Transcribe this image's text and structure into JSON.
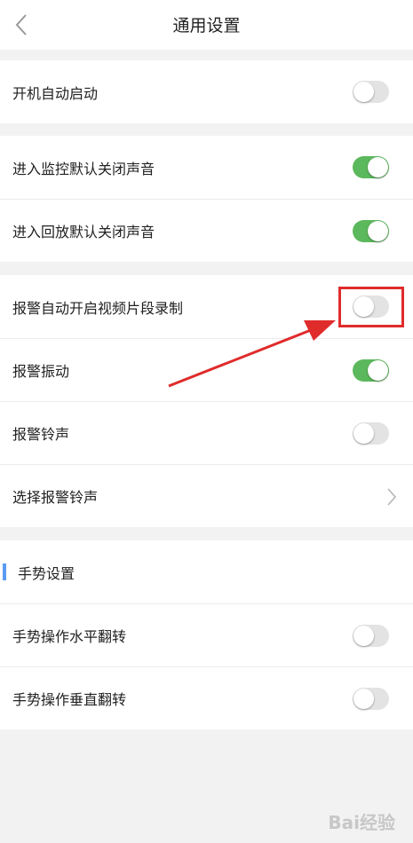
{
  "header": {
    "title": "通用设置"
  },
  "groups": [
    {
      "rows": [
        {
          "label": "开机自动启动",
          "toggle": false
        }
      ]
    },
    {
      "rows": [
        {
          "label": "进入监控默认关闭声音",
          "toggle": true
        },
        {
          "label": "进入回放默认关闭声音",
          "toggle": true
        }
      ]
    },
    {
      "rows": [
        {
          "label": "报警自动开启视频片段录制",
          "toggle": false
        },
        {
          "label": "报警振动",
          "toggle": true
        },
        {
          "label": "报警铃声",
          "toggle": false
        },
        {
          "label": "选择报警铃声",
          "chevron": true
        }
      ]
    },
    {
      "section_title": "手势设置",
      "rows": [
        {
          "label": "手势操作水平翻转",
          "toggle": false
        },
        {
          "label": "手势操作垂直翻转",
          "toggle": false
        }
      ]
    }
  ],
  "colors": {
    "toggle_on": "#5cb85c",
    "toggle_off": "#e3e3e3",
    "accent_bar": "#5b9bf3",
    "annotation": "#e02b2b"
  },
  "watermark": "Bai经验"
}
